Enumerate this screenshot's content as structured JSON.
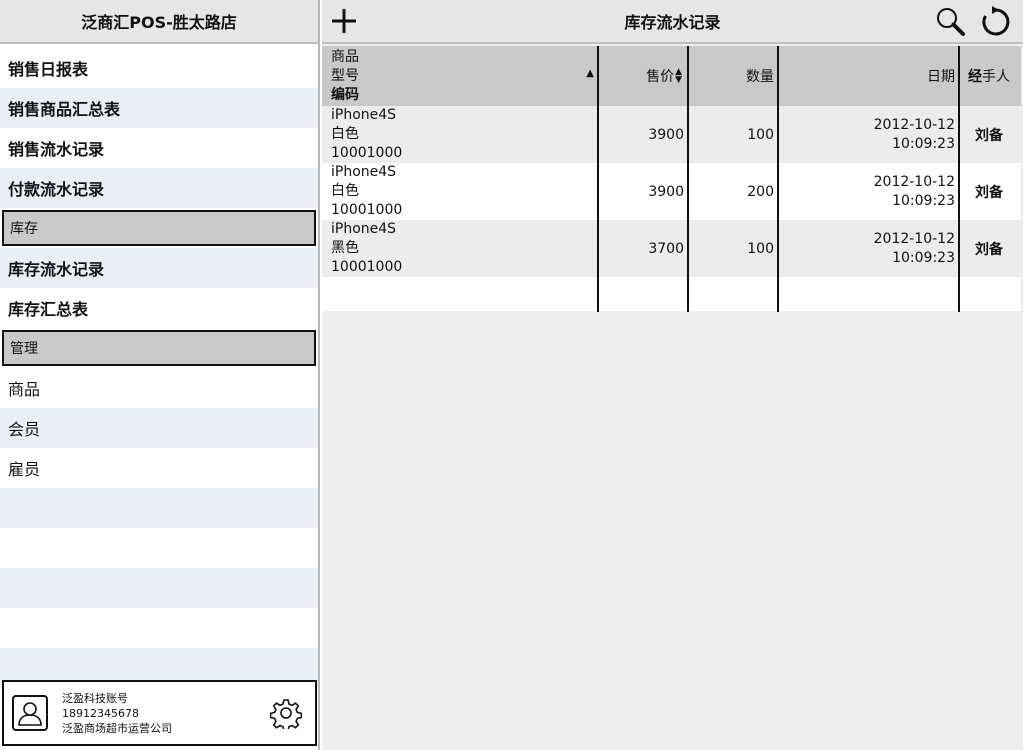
{
  "sidebar": {
    "store_title": "泛商汇POS-胜太路店",
    "items": [
      {
        "label": "销售日报表"
      },
      {
        "label": "销售商品汇总表"
      },
      {
        "label": "销售流水记录"
      },
      {
        "label": "付款流水记录"
      }
    ],
    "section_inventory": "库存",
    "inventory_items": [
      {
        "label": "库存流水记录"
      },
      {
        "label": "库存汇总表"
      }
    ],
    "section_manage": "管理",
    "manage_items": [
      {
        "label": "商品"
      },
      {
        "label": "会员"
      },
      {
        "label": "雇员"
      }
    ],
    "account": {
      "name": "泛盈科技账号",
      "phone": "18912345678",
      "company": "泛盈商场超市运营公司"
    }
  },
  "main": {
    "title": "库存流水记录",
    "columns": {
      "product_line1": "商品",
      "product_line2": "型号",
      "product_line3": "编码",
      "price": "售价",
      "quantity": "数量",
      "date": "日期",
      "handler_bold": "经",
      "handler_rest": "手人"
    },
    "rows": [
      {
        "name": "iPhone4S",
        "color": "白色",
        "code": "10001000",
        "price": "3900",
        "quantity": "100",
        "date": "2012-10-12",
        "time": "10:09:23",
        "handler": "刘备"
      },
      {
        "name": "iPhone4S",
        "color": "白色",
        "code": "10001000",
        "price": "3900",
        "quantity": "200",
        "date": "2012-10-12",
        "time": "10:09:23",
        "handler": "刘备"
      },
      {
        "name": "iPhone4S",
        "color": "黑色",
        "code": "10001000",
        "price": "3700",
        "quantity": "100",
        "date": "2012-10-12",
        "time": "10:09:23",
        "handler": "刘备"
      }
    ]
  },
  "icons": {
    "add": "plus-icon",
    "search": "search-icon",
    "refresh": "refresh-icon",
    "settings": "gear-icon",
    "user": "user-icon"
  }
}
